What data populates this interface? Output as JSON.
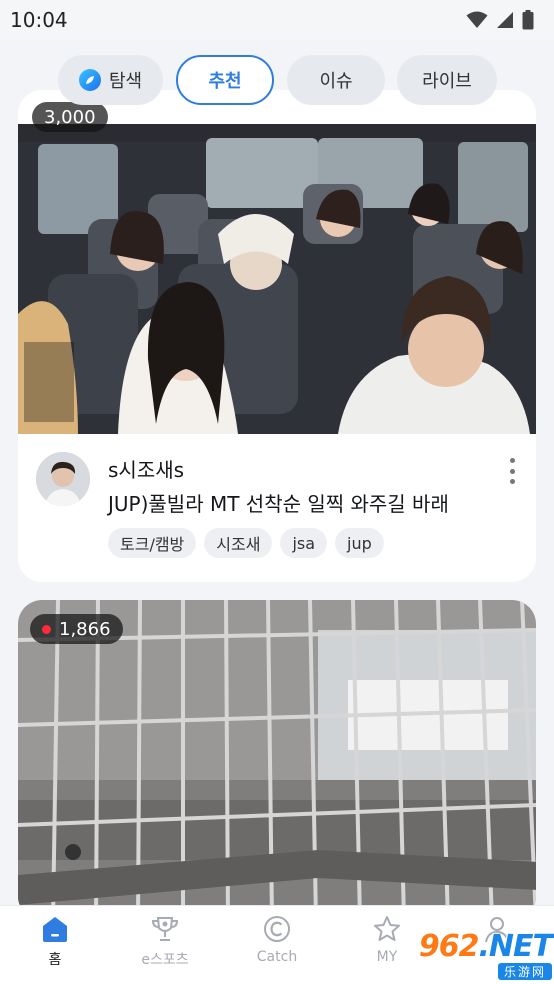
{
  "status_bar": {
    "time": "10:04"
  },
  "tabs": [
    {
      "label": "탐색",
      "active": false
    },
    {
      "label": "추천",
      "active": true
    },
    {
      "label": "이슈",
      "active": false
    },
    {
      "label": "라이브",
      "active": false
    }
  ],
  "feed": [
    {
      "viewers": "3,000",
      "streamer": "s시조새s",
      "title": "JUP)풀빌라 MT 선착순 일찍 와주길 바래",
      "tags": [
        "토크/캠방",
        "시조새",
        "jsa",
        "jup"
      ]
    },
    {
      "viewers": "1,866"
    }
  ],
  "bottom_nav": [
    {
      "label": "홈",
      "icon": "home-icon",
      "active": true
    },
    {
      "label": "e스포츠",
      "icon": "trophy-icon",
      "active": false
    },
    {
      "label": "Catch",
      "icon": "catch-icon",
      "active": false
    },
    {
      "label": "MY",
      "icon": "star-icon",
      "active": false
    },
    {
      "label": "",
      "icon": "profile-icon",
      "active": false
    }
  ],
  "watermark": {
    "main_a": "962",
    "main_b": ".NET",
    "sub": "乐游网"
  },
  "colors": {
    "accent": "#2f7de1",
    "live": "#ff2b3a",
    "background": "#f2f4f7"
  }
}
